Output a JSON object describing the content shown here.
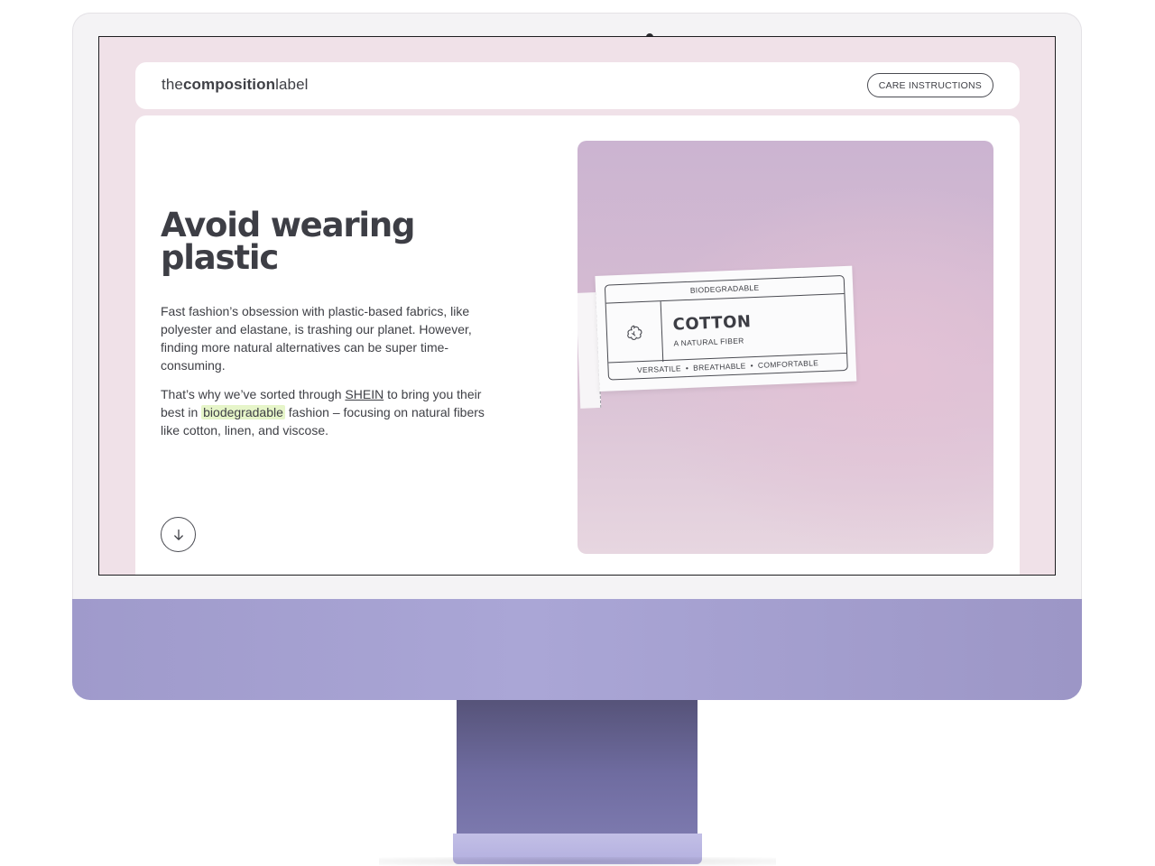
{
  "header": {
    "logo_prefix": "the",
    "logo_bold": "composition",
    "logo_suffix": "label",
    "care_button": "CARE INSTRUCTIONS"
  },
  "hero": {
    "headline_line1": "Avoid wearing",
    "headline_line2": "plastic",
    "paragraph1": "Fast fashion’s obsession with plastic-based fabrics, like polyester and elastane, is trashing our planet. However, finding more natural alternatives can be super time-consuming.",
    "paragraph2_part1": "That’s why we’ve sorted through ",
    "paragraph2_link": "SHEIN",
    "paragraph2_part2": " to bring you their best in ",
    "paragraph2_highlight": "biodegradable",
    "paragraph2_part3": " fashion – focusing on natural fibers like cotton, linen, and viscose."
  },
  "label": {
    "top_text": "BIODEGRADABLE",
    "fiber_name": "COTTON",
    "fiber_subtitle": "A NATURAL FIBER",
    "attributes": [
      "VERSATILE",
      "BREATHABLE",
      "COMFORTABLE"
    ],
    "separator": "•"
  },
  "icons": {
    "scroll": "arrow-down-icon",
    "cotton": "cotton-flower-icon",
    "scissors": "scissors-icon"
  },
  "colors": {
    "screen_background": "#f0e1e8",
    "text": "#3f4046",
    "highlight": "#e6f5c9",
    "hero_gradient_top": "#cbb4d1",
    "hero_gradient_bottom": "#e7d6e0",
    "device_body": "#aaa6d6"
  }
}
